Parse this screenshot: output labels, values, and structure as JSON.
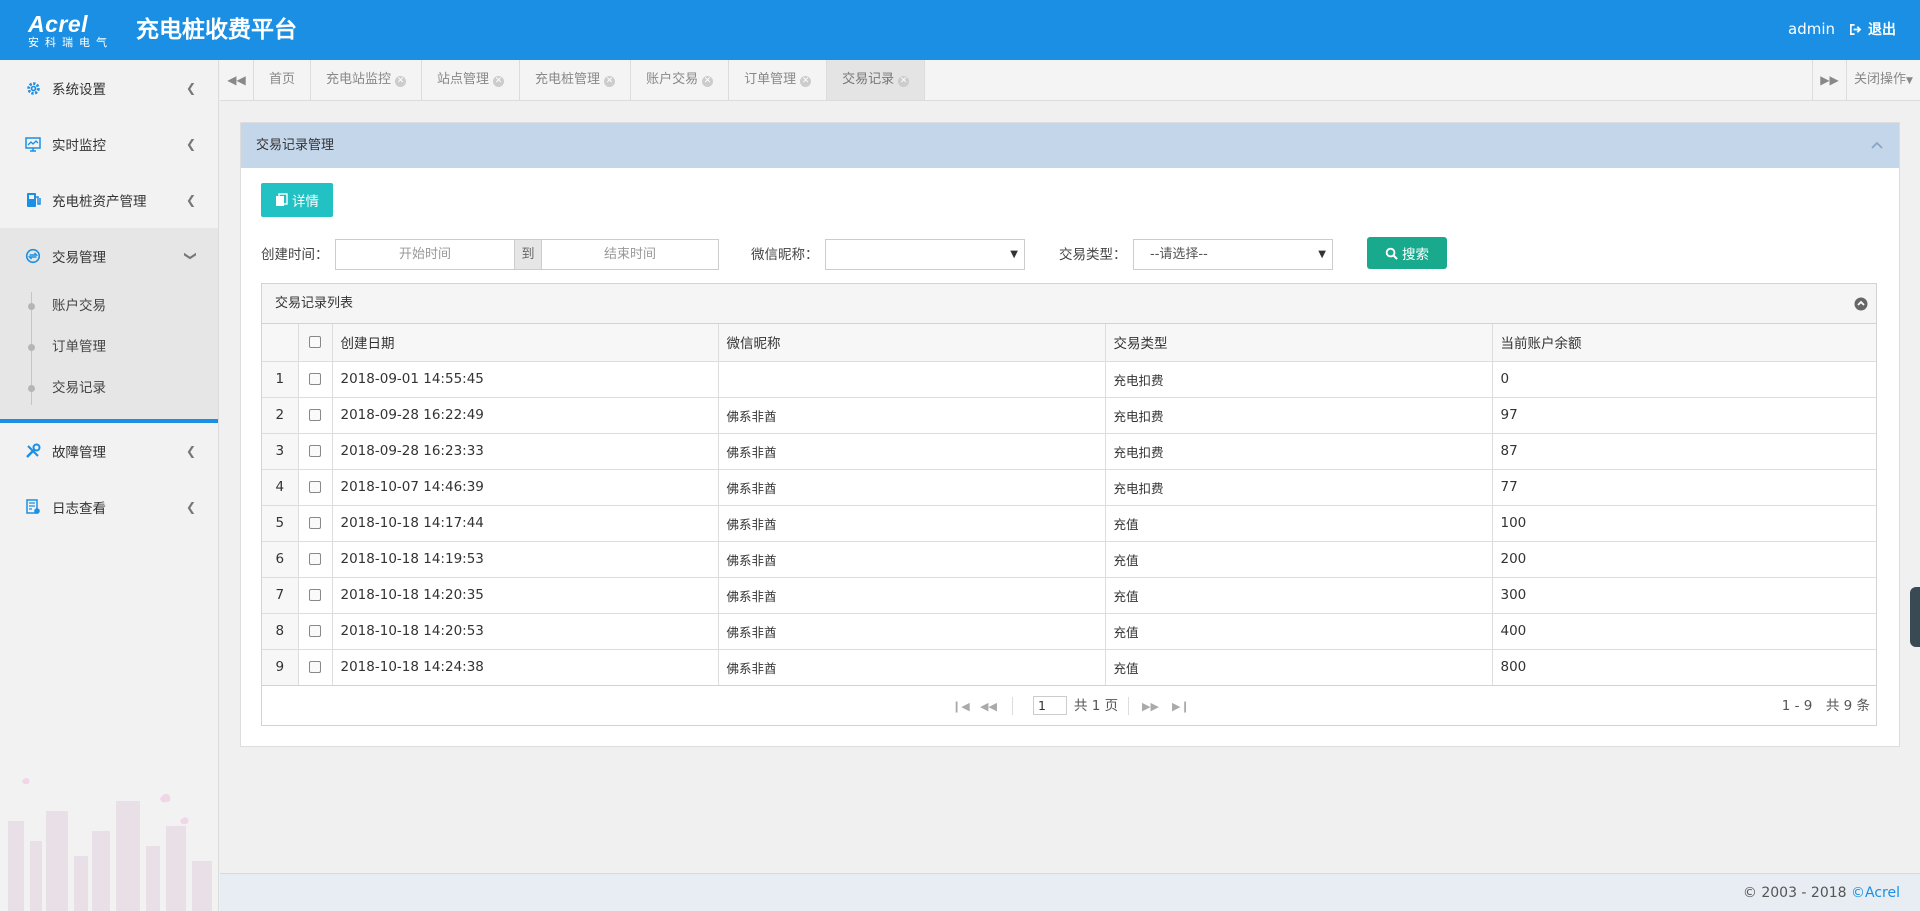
{
  "header": {
    "logo_text": "Acrel",
    "logo_sub": "安科瑞电气",
    "title": "充电桩收费平台",
    "username": "admin",
    "logout_label": "退出",
    "brand_color": "#1a8fe3"
  },
  "sidebar": {
    "items": [
      {
        "label": "系统设置",
        "icon": "gear-icon"
      },
      {
        "label": "实时监控",
        "icon": "monitor-icon"
      },
      {
        "label": "充电桩资产管理",
        "icon": "charging-pile-icon"
      },
      {
        "label": "交易管理",
        "icon": "transaction-icon",
        "expanded": true,
        "children": [
          {
            "label": "账户交易"
          },
          {
            "label": "订单管理"
          },
          {
            "label": "交易记录"
          }
        ]
      },
      {
        "label": "故障管理",
        "icon": "tools-icon"
      },
      {
        "label": "日志查看",
        "icon": "log-icon"
      }
    ]
  },
  "tabs": {
    "items": [
      "首页",
      "充电站监控",
      "站点管理",
      "充电桩管理",
      "账户交易",
      "订单管理",
      "交易记录"
    ],
    "active": "交易记录",
    "close_ops_label": "关闭操作"
  },
  "panel": {
    "title": "交易记录管理",
    "detail_button": "详情",
    "filters": {
      "created_label": "创建时间：",
      "start_placeholder": "开始时间",
      "to_label": "到",
      "end_placeholder": "结束时间",
      "nickname_label": "微信昵称：",
      "nickname_value": "",
      "type_label": "交易类型：",
      "type_value": "--请选择--",
      "search_button": "搜索"
    }
  },
  "grid": {
    "caption": "交易记录列表",
    "columns": [
      "创建日期",
      "微信昵称",
      "交易类型",
      "当前账户余额"
    ],
    "rows": [
      {
        "no": "1",
        "date": "2018-09-01 14:55:45",
        "nickname": "",
        "type": "充电扣费",
        "balance": "0"
      },
      {
        "no": "2",
        "date": "2018-09-28 16:22:49",
        "nickname": "佛系非酋",
        "type": "充电扣费",
        "balance": "97"
      },
      {
        "no": "3",
        "date": "2018-09-28 16:23:33",
        "nickname": "佛系非酋",
        "type": "充电扣费",
        "balance": "87"
      },
      {
        "no": "4",
        "date": "2018-10-07 14:46:39",
        "nickname": "佛系非酋",
        "type": "充电扣费",
        "balance": "77"
      },
      {
        "no": "5",
        "date": "2018-10-18 14:17:44",
        "nickname": "佛系非酋",
        "type": "充值",
        "balance": "100"
      },
      {
        "no": "6",
        "date": "2018-10-18 14:19:53",
        "nickname": "佛系非酋",
        "type": "充值",
        "balance": "200"
      },
      {
        "no": "7",
        "date": "2018-10-18 14:20:35",
        "nickname": "佛系非酋",
        "type": "充值",
        "balance": "300"
      },
      {
        "no": "8",
        "date": "2018-10-18 14:20:53",
        "nickname": "佛系非酋",
        "type": "充值",
        "balance": "400"
      },
      {
        "no": "9",
        "date": "2018-10-18 14:24:38",
        "nickname": "佛系非酋",
        "type": "充值",
        "balance": "800"
      }
    ],
    "pager": {
      "page": "1",
      "total_pages_text": "共 1 页",
      "info_text": "1 - 9　共 9 条"
    }
  },
  "footer": {
    "copyright": "© 2003 - 2018 ",
    "brand": "©Acrel"
  }
}
